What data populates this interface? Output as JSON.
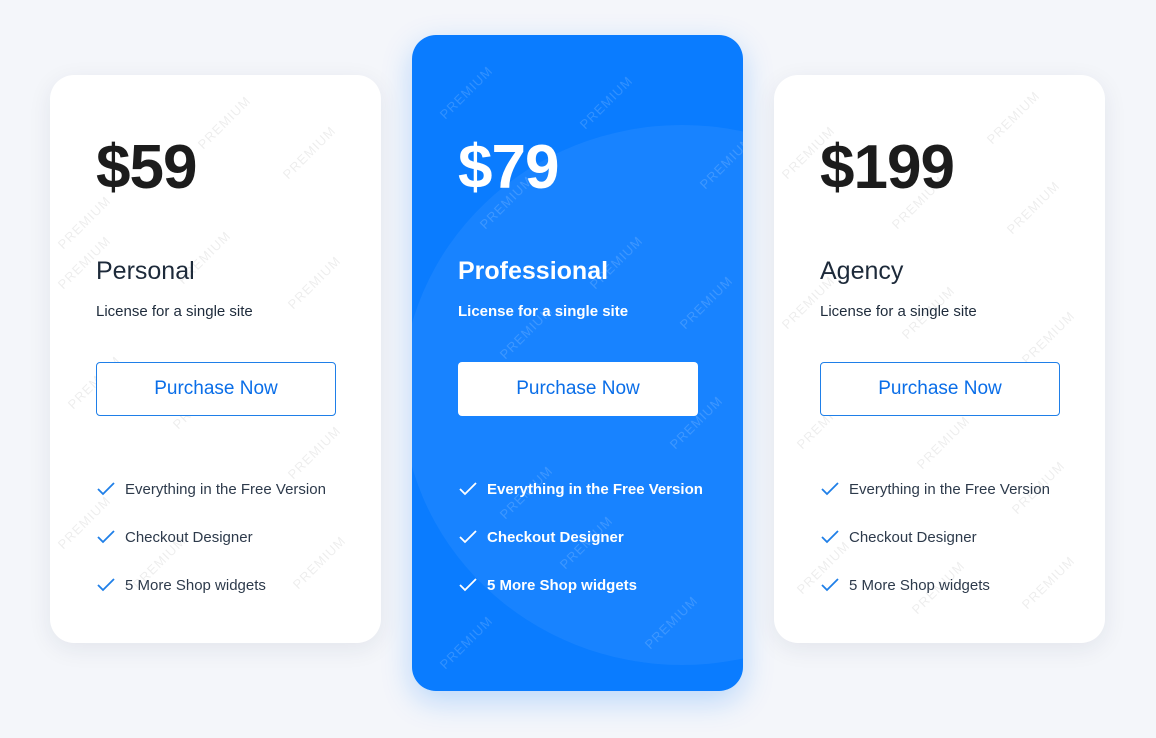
{
  "watermark_text": "PREMIUM",
  "colors": {
    "accent": "#0a7cff",
    "featured_background": "#0a7cff",
    "page_background": "#f4f6fa",
    "check": "#1f7fe8"
  },
  "plans": [
    {
      "price": "$59",
      "name": "Personal",
      "description": "License for a single site",
      "button_label": "Purchase Now",
      "featured": false,
      "features": [
        "Everything in the Free Version",
        "Checkout Designer",
        "5 More Shop widgets"
      ]
    },
    {
      "price": "$79",
      "name": "Professional",
      "description": "License for a single site",
      "button_label": "Purchase Now",
      "featured": true,
      "features": [
        "Everything in the Free Version",
        "Checkout Designer",
        "5 More Shop widgets"
      ]
    },
    {
      "price": "$199",
      "name": "Agency",
      "description": "License for a single site",
      "button_label": "Purchase Now",
      "featured": false,
      "features": [
        "Everything in the Free Version",
        "Checkout Designer",
        "5 More Shop widgets"
      ]
    }
  ],
  "icons": {
    "feature_check": "check-icon"
  }
}
